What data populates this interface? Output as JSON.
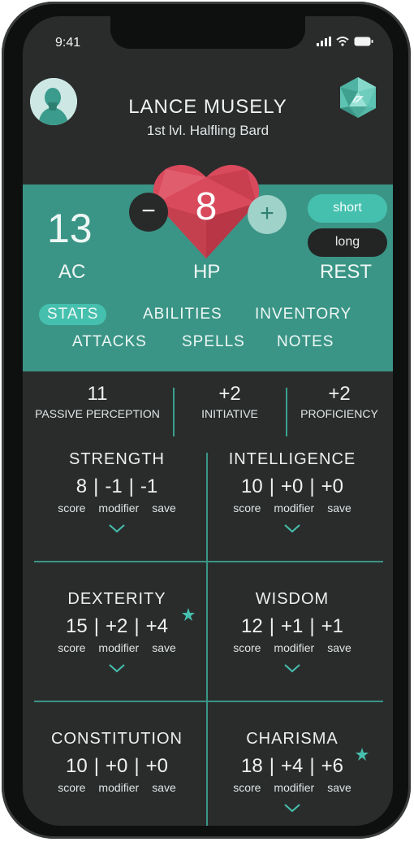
{
  "status_bar": {
    "time": "9:41"
  },
  "header": {
    "name": "LANCE MUSELY",
    "subtitle": "1st lvl. Halfling Bard"
  },
  "vitals": {
    "ac_value": "13",
    "ac_label": "AC",
    "hp_value": "8",
    "hp_label": "HP",
    "minus_label": "−",
    "plus_label": "+",
    "rest_label": "REST",
    "short_label": "short",
    "long_label": "long"
  },
  "tabs": [
    {
      "label": "STATS",
      "active": true
    },
    {
      "label": "ABILITIES",
      "active": false
    },
    {
      "label": "INVENTORY",
      "active": false
    },
    {
      "label": "ATTACKS",
      "active": false
    },
    {
      "label": "SPELLS",
      "active": false
    },
    {
      "label": "NOTES",
      "active": false
    }
  ],
  "quick_stats": [
    {
      "value": "11",
      "label": "PASSIVE PERCEPTION"
    },
    {
      "value": "+2",
      "label": "INITIATIVE"
    },
    {
      "value": "+2",
      "label": "PROFICIENCY"
    }
  ],
  "stat_labels": {
    "score": "score",
    "modifier": "modifier",
    "save": "save"
  },
  "abilities": [
    {
      "name": "STRENGTH",
      "score": "8",
      "modifier": "-1",
      "save": "-1",
      "proficient": false
    },
    {
      "name": "INTELLIGENCE",
      "score": "10",
      "modifier": "+0",
      "save": "+0",
      "proficient": false
    },
    {
      "name": "DEXTERITY",
      "score": "15",
      "modifier": "+2",
      "save": "+4",
      "proficient": true
    },
    {
      "name": "WISDOM",
      "score": "12",
      "modifier": "+1",
      "save": "+1",
      "proficient": false
    },
    {
      "name": "CONSTITUTION",
      "score": "10",
      "modifier": "+0",
      "save": "+0",
      "proficient": false
    },
    {
      "name": "CHARISMA",
      "score": "18",
      "modifier": "+4",
      "save": "+6",
      "proficient": true
    }
  ],
  "colors": {
    "accent": "#3a9586",
    "accent_light": "#46c0ae",
    "heart": "#d94a5c",
    "background": "#2a2c2c"
  },
  "icons": {
    "avatar": "bard-avatar",
    "dice": "d20-icon",
    "expand": "chevron-down-icon",
    "proficient": "star-icon"
  }
}
